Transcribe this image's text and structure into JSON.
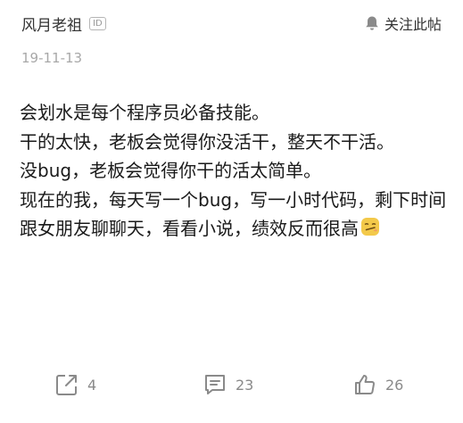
{
  "post": {
    "author": "风月老祖",
    "id_badge": "ID",
    "follow_label": "关注此帖",
    "date": "19-11-13",
    "body_lines": [
      "会划水是每个程序员必备技能。",
      "干的太快，老板会觉得你没活干，整天不干活。",
      "没bug，老板会觉得你干的活太简单。",
      "现在的我，每天写一个bug，写一小时代码，剩下时间跟女朋友聊聊天，看看小说，绩效反而很高"
    ],
    "emoji": "smirk-emoji"
  },
  "actions": {
    "share": {
      "icon": "share-icon",
      "count": "4"
    },
    "comment": {
      "icon": "comment-icon",
      "count": "23"
    },
    "like": {
      "icon": "thumbs-up-icon",
      "count": "26"
    }
  },
  "colors": {
    "text": "#1a1a1a",
    "muted": "#a8a8a8",
    "icon": "#8a8a8a",
    "emoji": "#f3c94a"
  }
}
